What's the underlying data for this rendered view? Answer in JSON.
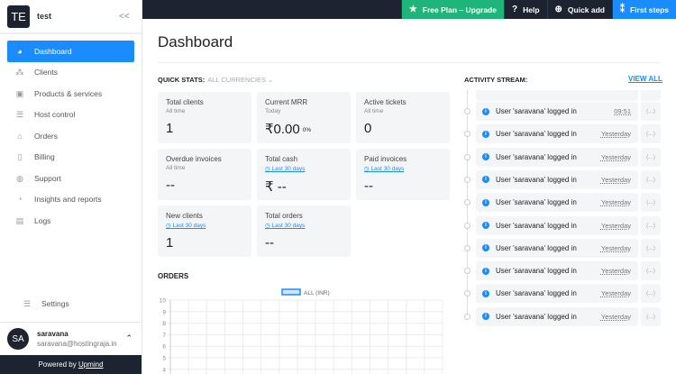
{
  "sidebar": {
    "logo": "TE",
    "workspace": "test",
    "collapse": "<<",
    "items": [
      {
        "label": "Dashboard",
        "icon": "gauge-icon"
      },
      {
        "label": "Clients",
        "icon": "users-icon"
      },
      {
        "label": "Products & services",
        "icon": "box-icon"
      },
      {
        "label": "Host control",
        "icon": "server-icon"
      },
      {
        "label": "Orders",
        "icon": "basket-icon"
      },
      {
        "label": "Billing",
        "icon": "invoice-icon"
      },
      {
        "label": "Support",
        "icon": "chat-icon"
      },
      {
        "label": "Insights and reports",
        "icon": "pie-icon"
      },
      {
        "label": "Logs",
        "icon": "clipboard-icon"
      }
    ],
    "settings": "Settings",
    "user": {
      "initials": "SA",
      "name": "saravana",
      "email": "saravana@hostingraja.in"
    },
    "powered": "Powered by",
    "powered_link": "Upmind"
  },
  "topbar": {
    "upgrade": "Free Plan – Upgrade",
    "help": "Help",
    "quick_add": "Quick add",
    "first_steps": "First steps"
  },
  "page_title": "Dashboard",
  "quick_stats": {
    "label": "QUICK STATS:",
    "currency": "ALL CURRENCIES",
    "cards": [
      {
        "title": "Total clients",
        "sub": "All time",
        "value": "1"
      },
      {
        "title": "Current MRR",
        "sub": "Today",
        "value": "₹0.00",
        "delta": "0%"
      },
      {
        "title": "Active tickets",
        "sub": "All time",
        "value": "0"
      },
      {
        "title": "Overdue invoices",
        "sub": "All time",
        "value": "--"
      },
      {
        "title": "Total cash",
        "sub": "Last 30 days",
        "value": "₹ --"
      },
      {
        "title": "Paid invoices",
        "sub": "Last 30 days",
        "value": "--"
      },
      {
        "title": "New clients",
        "sub": "Last 30 days",
        "value": "1"
      },
      {
        "title": "Total orders",
        "sub": "Last 30 days",
        "value": "--"
      }
    ]
  },
  "orders": {
    "title": "ORDERS"
  },
  "chart_data": {
    "type": "line",
    "legend": [
      "ALL (INR)"
    ],
    "yticks": [
      "10",
      "9",
      "8",
      "7",
      "6",
      "5",
      "4"
    ],
    "ylim": [
      4,
      10
    ],
    "series": [
      {
        "name": "ALL (INR)",
        "values": []
      }
    ],
    "grid": true,
    "legend_position": "top"
  },
  "activity": {
    "title": "ACTIVITY STREAM:",
    "view_all": "VIEW ALL",
    "more": "(...)",
    "items": [
      {
        "text": "User 'saravana' logged in",
        "time": "09:51"
      },
      {
        "text": "User 'saravana' logged in",
        "time": "Yesterday"
      },
      {
        "text": "User 'saravana' logged in",
        "time": "Yesterday"
      },
      {
        "text": "User 'saravana' logged in",
        "time": "Yesterday"
      },
      {
        "text": "User 'saravana' logged in",
        "time": "Yesterday"
      },
      {
        "text": "User 'saravana' logged in",
        "time": "Yesterday"
      },
      {
        "text": "User 'saravana' logged in",
        "time": "Yesterday"
      },
      {
        "text": "User 'saravana' logged in",
        "time": "Yesterday"
      },
      {
        "text": "User 'saravana' logged in",
        "time": "Yesterday"
      },
      {
        "text": "User 'saravana' logged in",
        "time": "Yesterday"
      }
    ]
  }
}
